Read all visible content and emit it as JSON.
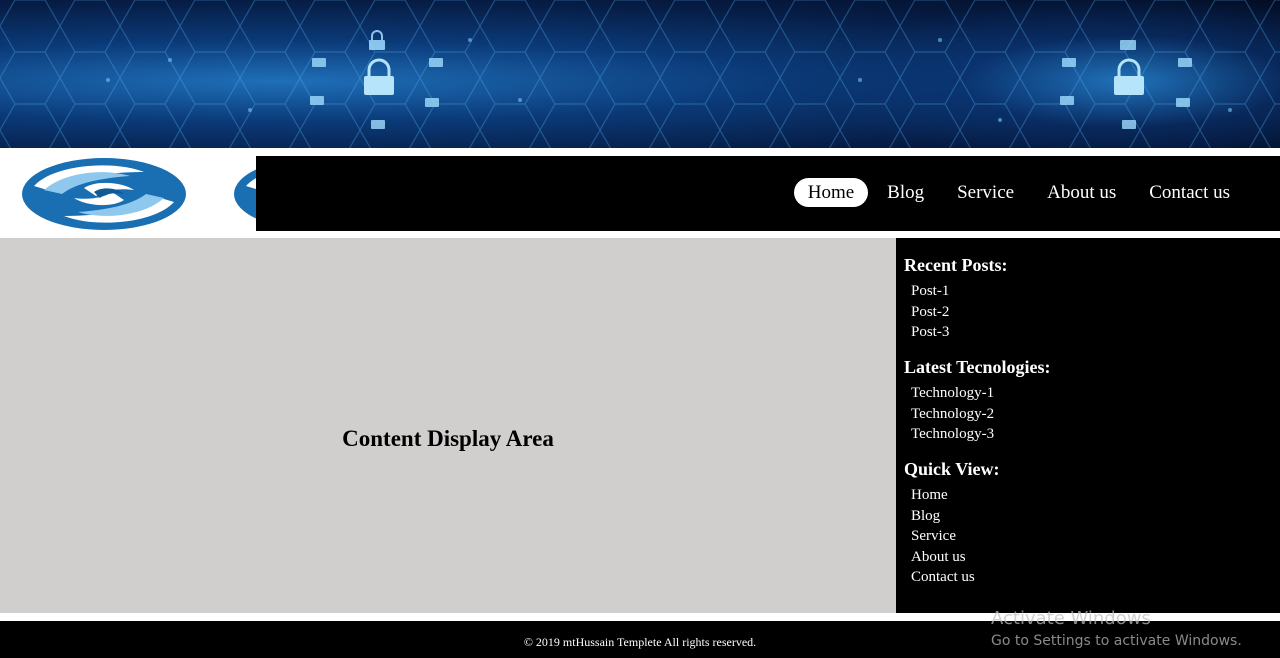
{
  "navigation": {
    "items": [
      {
        "label": "Home"
      },
      {
        "label": "Blog"
      },
      {
        "label": "Service"
      },
      {
        "label": "About us"
      },
      {
        "label": "Contact us"
      }
    ]
  },
  "main": {
    "title": "Content Display Area"
  },
  "sidebar": {
    "recent_posts": {
      "heading": "Recent Posts:",
      "items": [
        "Post-1",
        "Post-2",
        "Post-3"
      ]
    },
    "latest_tech": {
      "heading": "Latest Tecnologies:",
      "items": [
        "Technology-1",
        "Technology-2",
        "Technology-3"
      ]
    },
    "quick_view": {
      "heading": "Quick View:",
      "items": [
        "Home",
        "Blog",
        "Service",
        "About us",
        "Contact us"
      ]
    }
  },
  "footer": {
    "copyright": "© 2019 mtHussain Templete All rights reserved."
  },
  "watermark": {
    "line1": "Activate Windows",
    "line2": "Go to Settings to activate Windows."
  },
  "colors": {
    "content_bg": "#d1cece",
    "nav_bg": "#000000",
    "banner_accent": "#1f6fb8"
  },
  "icons": [
    "lock-icon",
    "site-logo"
  ]
}
